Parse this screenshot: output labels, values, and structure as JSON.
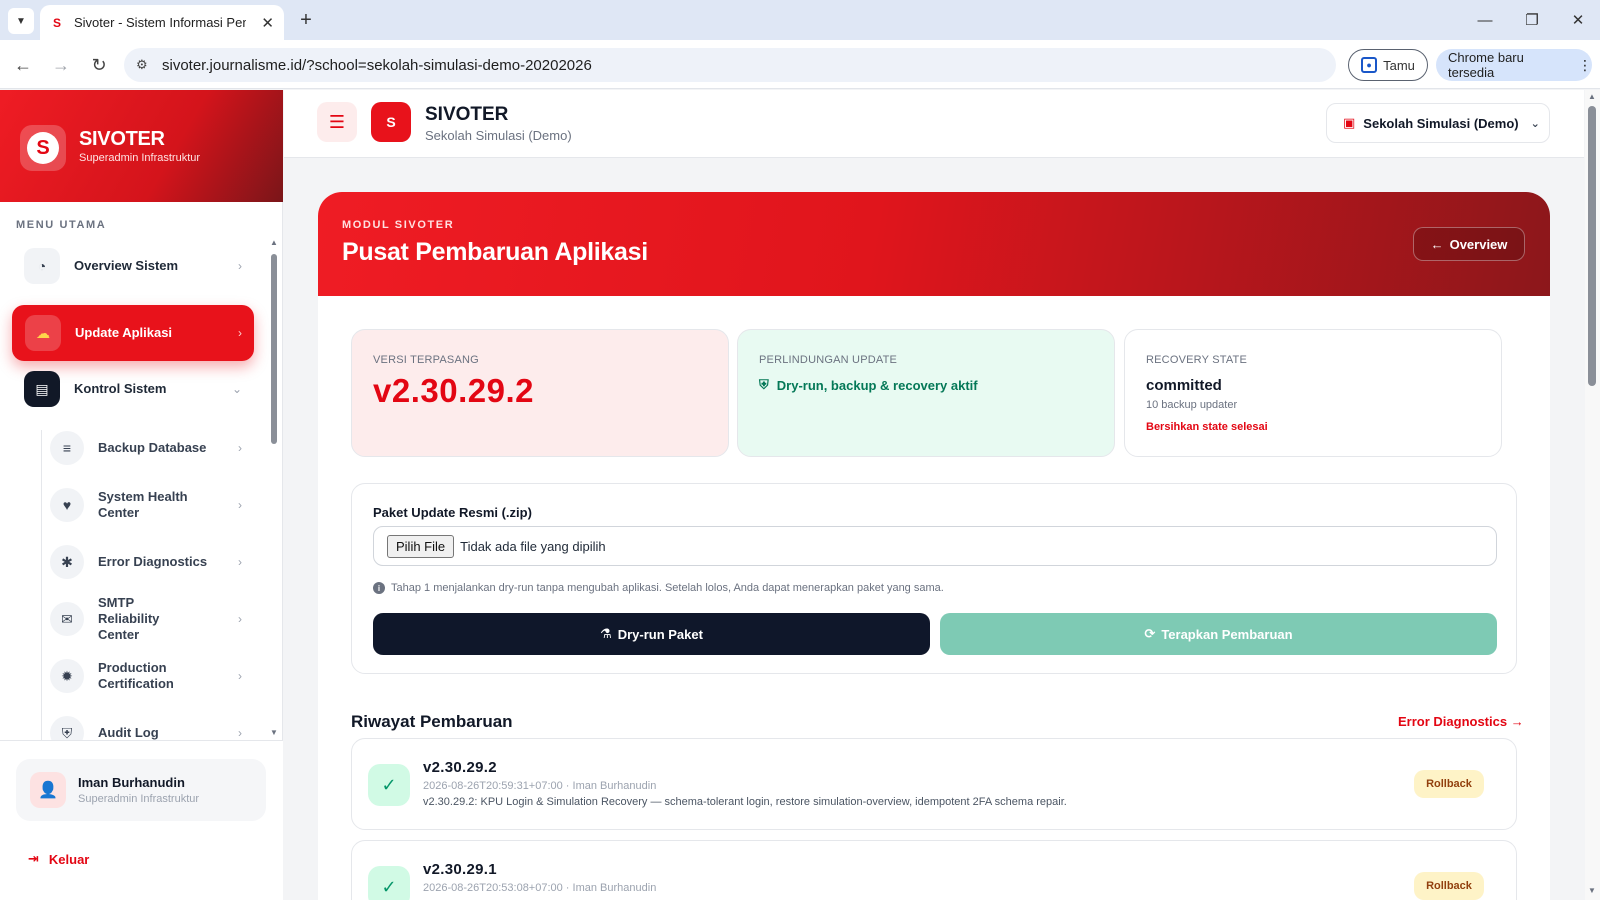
{
  "browser": {
    "tab_title": "Sivoter - Sistem Informasi Pemilihan",
    "url": "sivoter.journalisme.id/?school=sekolah-simulasi-demo-20202026",
    "guest_label": "Tamu",
    "update_label": "Chrome baru tersedia"
  },
  "sidebar": {
    "brand": "SIVOTER",
    "brand_sub": "Superadmin Infrastruktur",
    "menu_label": "MENU UTAMA",
    "items": [
      {
        "label": "Overview Sistem",
        "icon": "gauge-icon"
      },
      {
        "label": "Update Aplikasi",
        "icon": "cloud-upload-icon"
      },
      {
        "label": "Kontrol Sistem",
        "icon": "server-icon"
      }
    ],
    "subitems": [
      {
        "label": "Backup Database",
        "icon": "database-icon"
      },
      {
        "label": "System Health Center",
        "icon": "heart-pulse-icon"
      },
      {
        "label": "Error Diagnostics",
        "icon": "bug-icon"
      },
      {
        "label": "SMTP Reliability Center",
        "icon": "mail-icon"
      },
      {
        "label": "Production Certification",
        "icon": "certificate-icon"
      },
      {
        "label": "Audit Log",
        "icon": "shield-icon"
      }
    ],
    "user": {
      "name": "Iman Burhanudin",
      "role": "Superadmin Infrastruktur"
    },
    "logout_label": "Keluar"
  },
  "header": {
    "title": "SIVOTER",
    "subtitle": "Sekolah Simulasi (Demo)",
    "school_selected": "Sekolah Simulasi (Demo)"
  },
  "hero": {
    "kicker": "MODUL SIVOTER",
    "title": "Pusat Pembaruan Aplikasi",
    "back_label": "Overview"
  },
  "stats": {
    "installed_label": "VERSI TERPASANG",
    "installed_version": "v2.30.29.2",
    "protection_label": "PERLINDUNGAN UPDATE",
    "protection_value": "Dry-run, backup & recovery aktif",
    "recovery_label": "RECOVERY STATE",
    "recovery_value": "committed",
    "backup_count": "10 backup updater",
    "clear_label": "Bersihkan state selesai"
  },
  "upload": {
    "label": "Paket Update Resmi (.zip)",
    "file_button": "Pilih File",
    "file_status": "Tidak ada file yang dipilih",
    "hint": "Tahap 1 menjalankan dry-run tanpa mengubah aplikasi. Setelah lolos, Anda dapat menerapkan paket yang sama.",
    "dry_run_label": "Dry-run Paket",
    "apply_label": "Terapkan Pembaruan"
  },
  "history": {
    "title": "Riwayat Pembaruan",
    "link_label": "Error Diagnostics →",
    "rollback_label": "Rollback",
    "rows": [
      {
        "version": "v2.30.29.2",
        "meta": "2026-08-26T20:59:31+07:00 · Iman Burhanudin",
        "note": "v2.30.29.2: KPU Login & Simulation Recovery — schema-tolerant login, restore simulation-overview, idempotent 2FA schema repair."
      },
      {
        "version": "v2.30.29.1",
        "meta": "2026-08-26T20:53:08+07:00 · Iman Burhanudin",
        "note": ""
      }
    ]
  },
  "colors": {
    "brand_red": "#e8121b",
    "dark": "#0f172a",
    "success": "#047857",
    "apply_button": "#7ecab4"
  }
}
